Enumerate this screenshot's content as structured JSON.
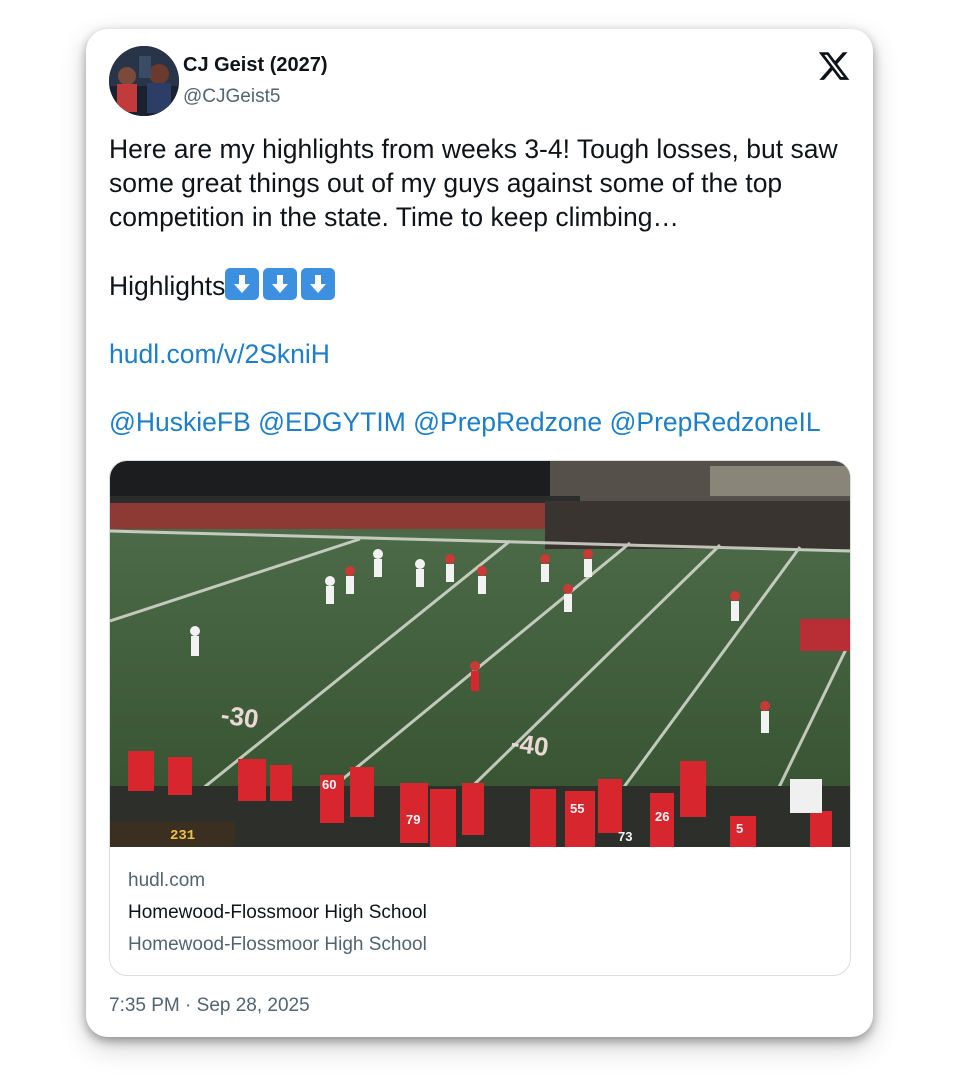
{
  "author": {
    "name": "CJ Geist (2027)",
    "handle": "@CJGeist5"
  },
  "tweet": {
    "paragraph1": "Here are my highlights from weeks 3-4! Tough losses, but saw some great things out of my guys against some of the top competition in the state. Time to keep climbing…",
    "highlights_label": "Highlights",
    "link": "hudl.com/v/2SkniH",
    "mentions": [
      "@HuskieFB",
      "@EDGYTIM",
      "@PrepRedzone",
      "@PrepRedzoneIL"
    ]
  },
  "link_card": {
    "domain": "hudl.com",
    "title": "Homewood-Flossmoor High School",
    "description": "Homewood-Flossmoor High School",
    "scoreboard": "231"
  },
  "timestamp": "7:35 PM · Sep 28, 2025",
  "colors": {
    "link": "#1d7ec9",
    "text": "#0f1419",
    "secondary": "#536471",
    "field_green": "#3d5a3a",
    "team_red": "#d8262f"
  }
}
